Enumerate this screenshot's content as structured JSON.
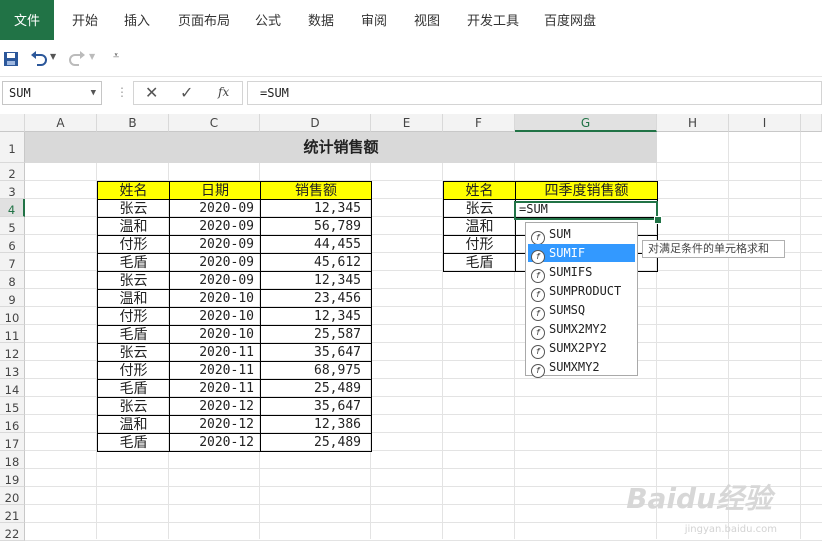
{
  "ribbon": {
    "tabs": [
      "文件",
      "开始",
      "插入",
      "页面布局",
      "公式",
      "数据",
      "审阅",
      "视图",
      "开发工具",
      "百度网盘"
    ]
  },
  "formula_bar": {
    "name_box": "SUM",
    "formula": "=SUM",
    "fx_label": "fx"
  },
  "columns": [
    "A",
    "B",
    "C",
    "D",
    "E",
    "F",
    "G",
    "H",
    "I"
  ],
  "rows": [
    "1",
    "2",
    "3",
    "4",
    "5",
    "6",
    "7",
    "8",
    "9",
    "10",
    "11",
    "12",
    "13",
    "14",
    "15",
    "16",
    "17",
    "18",
    "19",
    "20",
    "21",
    "22"
  ],
  "sheet": {
    "title": "统计销售额",
    "table1": {
      "headers": [
        "姓名",
        "日期",
        "销售额"
      ],
      "rows": [
        [
          "张云",
          "2020-09",
          "12,345"
        ],
        [
          "温和",
          "2020-09",
          "56,789"
        ],
        [
          "付形",
          "2020-09",
          "44,455"
        ],
        [
          "毛盾",
          "2020-09",
          "45,612"
        ],
        [
          "张云",
          "2020-09",
          "12,345"
        ],
        [
          "温和",
          "2020-10",
          "23,456"
        ],
        [
          "付形",
          "2020-10",
          "12,345"
        ],
        [
          "毛盾",
          "2020-10",
          "25,587"
        ],
        [
          "张云",
          "2020-11",
          "35,647"
        ],
        [
          "付形",
          "2020-11",
          "68,975"
        ],
        [
          "毛盾",
          "2020-11",
          "25,489"
        ],
        [
          "张云",
          "2020-12",
          "35,647"
        ],
        [
          "温和",
          "2020-12",
          "12,386"
        ],
        [
          "毛盾",
          "2020-12",
          "25,489"
        ]
      ]
    },
    "table2": {
      "headers": [
        "姓名",
        "四季度销售额"
      ],
      "rows": [
        [
          "张云",
          "=SUM"
        ],
        [
          "温和",
          ""
        ],
        [
          "付形",
          ""
        ],
        [
          "毛盾",
          ""
        ]
      ]
    }
  },
  "autocomplete": {
    "items": [
      "SUM",
      "SUMIF",
      "SUMIFS",
      "SUMPRODUCT",
      "SUMSQ",
      "SUMX2MY2",
      "SUMX2PY2",
      "SUMXMY2"
    ],
    "selected_index": 1,
    "tooltip": "对满足条件的单元格求和"
  },
  "watermark": {
    "brand": "Baidu经验",
    "url": "jingyan.baidu.com"
  },
  "colors": {
    "accent": "#217346",
    "header_fill": "#ffff00",
    "selection": "#3399ff"
  }
}
